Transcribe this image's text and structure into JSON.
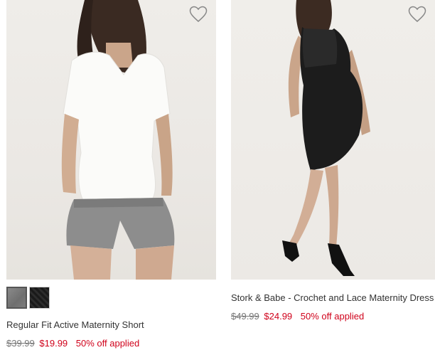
{
  "products": [
    {
      "name": "Regular Fit Active Maternity Short",
      "price_original": "$39.99",
      "price_sale": "$19.99",
      "promo": "50% off applied",
      "image": "woman-white-tee-grey-shorts",
      "swatches": [
        "grey",
        "black"
      ],
      "wishlist_icon": "heart-outline-icon"
    },
    {
      "name": "Stork & Babe - Crochet and Lace Maternity Dress",
      "price_original": "$49.99",
      "price_sale": "$24.99",
      "promo": "50% off applied",
      "image": "woman-black-ruched-dress",
      "wishlist_icon": "heart-outline-icon"
    }
  ],
  "colors": {
    "sale_red": "#d0021b",
    "text": "#333333",
    "muted": "#777777"
  }
}
